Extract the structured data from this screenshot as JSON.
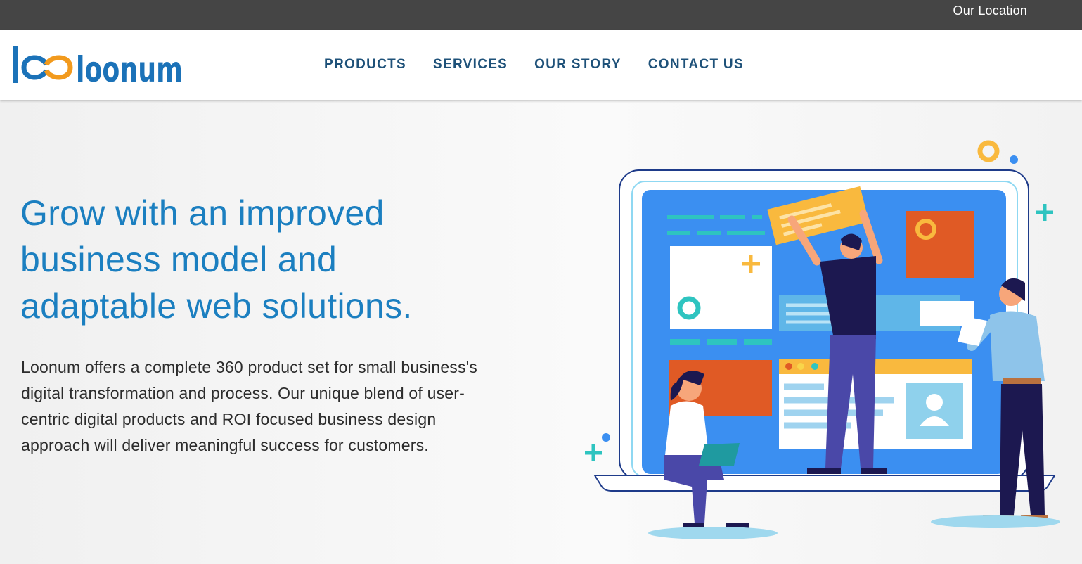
{
  "topbar": {
    "location_label": "Our Location"
  },
  "brand": {
    "name": "loonum",
    "primary_color": "#1b72b8",
    "accent_color": "#f29a1d"
  },
  "nav": {
    "items": [
      {
        "label": "PRODUCTS"
      },
      {
        "label": "SERVICES"
      },
      {
        "label": "OUR STORY"
      },
      {
        "label": "CONTACT US"
      }
    ]
  },
  "hero": {
    "headline_lines": [
      "Grow with an improved",
      "business model and",
      "adaptable web solutions."
    ],
    "description": "Loonum offers a complete 360 product set for small business's digital transformation and process. Our unique blend of user-centric digital products and ROI focused business design approach will deliver meaningful success for customers.",
    "illustration": "team-building-website-illustration"
  }
}
